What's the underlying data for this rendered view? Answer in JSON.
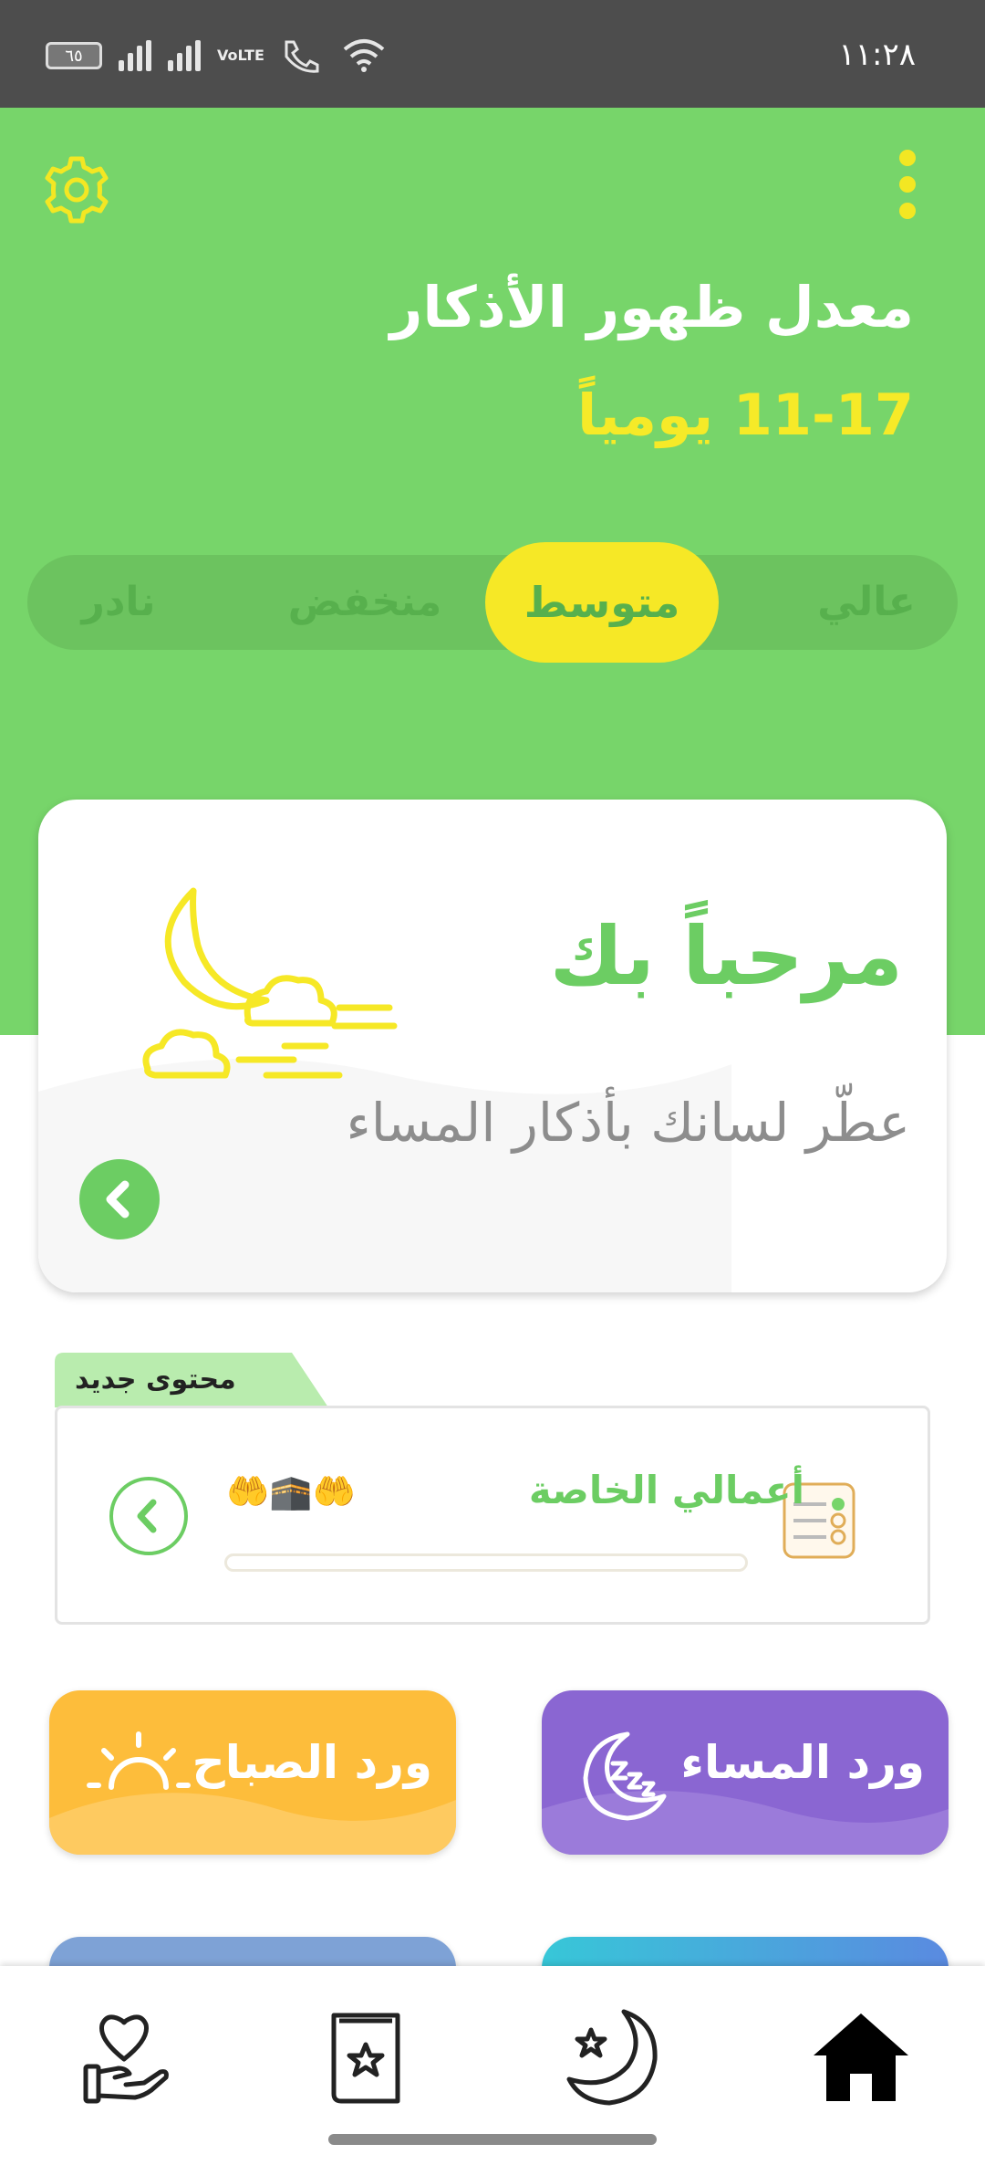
{
  "status_bar": {
    "time": "١١:٢٨",
    "battery": "٦٥",
    "network": "VoLTE"
  },
  "header": {
    "settings_icon": "gear-icon",
    "menu_icon": "more-vertical-icon",
    "title": "معدل ظهور الأذكار",
    "frequency_range": "11-17 يومياً"
  },
  "frequency_selector": {
    "options": [
      "عالي",
      "متوسط",
      "منخفض",
      "نادر"
    ],
    "selected": "متوسط"
  },
  "welcome_card": {
    "title": "مرحباً بك",
    "subtitle": "عطّر لسانك بأذكار المساء",
    "icon": "moon-clouds-icon"
  },
  "new_content": {
    "tab_label": "محتوى جديد",
    "title": "أعمالي الخاصة",
    "emoji": "🤲🕋🤲",
    "progress": 0
  },
  "tiles": {
    "morning": "ورد الصباح",
    "evening": "ورد المساء"
  },
  "bottom_nav": [
    "home-icon",
    "moon-star-icon",
    "book-star-icon",
    "heart-hand-icon"
  ],
  "colors": {
    "primary_green": "#77d56a",
    "accent_yellow": "#f6e826",
    "morning_tile": "#fdbd3b",
    "evening_tile": "#8a66d2"
  }
}
